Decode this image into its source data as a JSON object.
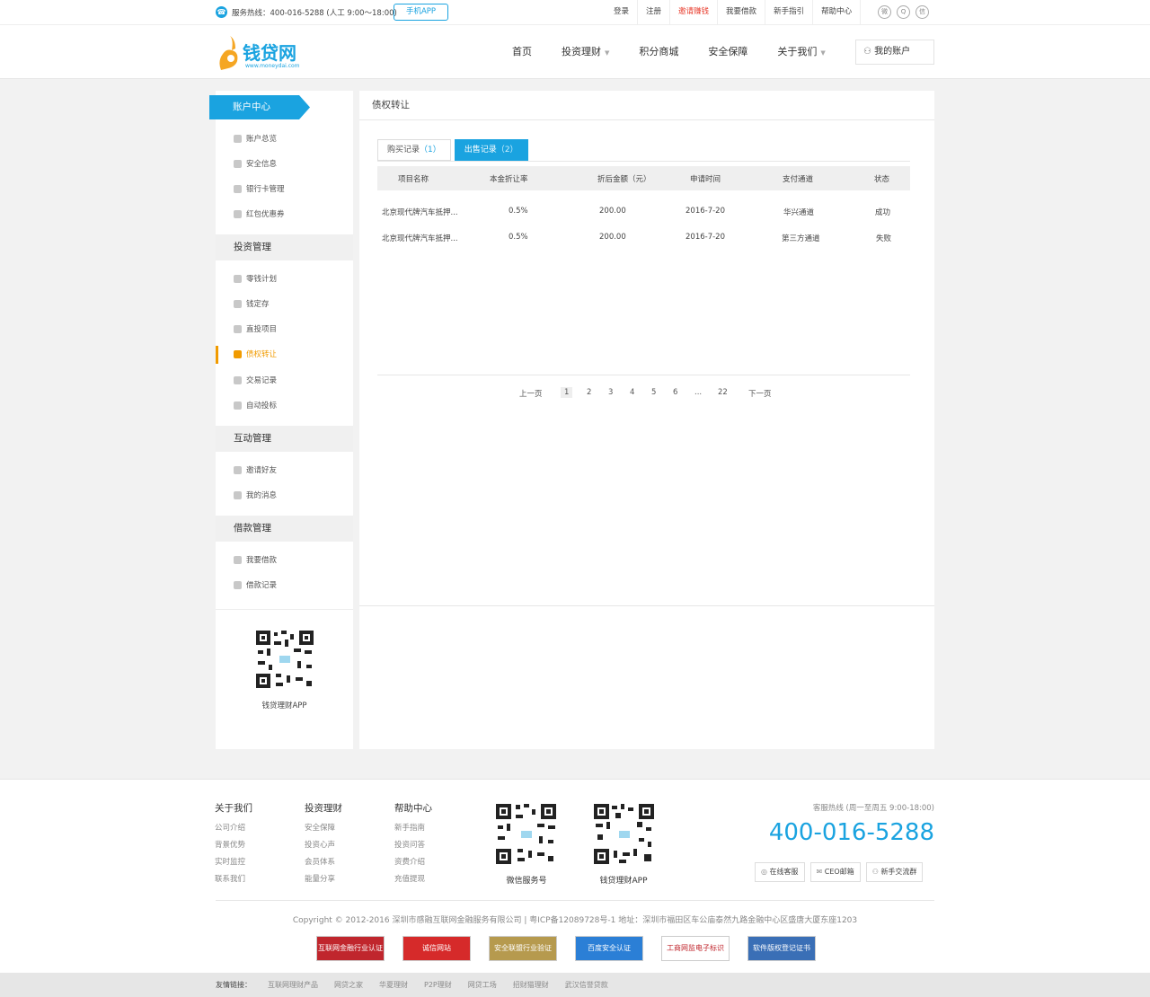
{
  "topbar": {
    "hotline": "服务热线：400-016-5288 (人工 9:00～18:00)",
    "app_button": "手机APP",
    "links": [
      "登录",
      "注册",
      "邀请赚钱",
      "我要借款",
      "新手指引",
      "帮助中心"
    ]
  },
  "header": {
    "logo_text": "钱贷网",
    "logo_url": "www.moneydai.com",
    "nav": [
      "首页",
      "投资理财",
      "积分商城",
      "安全保障",
      "关于我们"
    ],
    "my_account": "我的账户"
  },
  "sidebar": {
    "head": "账户中心",
    "account_items": [
      "账户总览",
      "安全信息",
      "银行卡管理",
      "红包优惠券"
    ],
    "group_invest": "投资管理",
    "invest_items": [
      "零钱计划",
      "钱定存",
      "直投项目",
      "债权转让",
      "交易记录",
      "自动投标"
    ],
    "group_interact": "互动管理",
    "interact_items": [
      "邀请好友",
      "我的消息"
    ],
    "group_loan": "借款管理",
    "loan_items": [
      "我要借款",
      "借款记录"
    ],
    "qr_caption": "钱贷理财APP"
  },
  "main": {
    "title": "债权转让",
    "tabs": [
      {
        "label": "购买记录",
        "count": "1"
      },
      {
        "label": "出售记录",
        "count": "2"
      }
    ],
    "columns": [
      "项目名称",
      "本金折让率",
      "折后金额（元）",
      "申请时间",
      "支付通道",
      "状态"
    ],
    "rows": [
      [
        "北京现代牌汽车抵押...",
        "0.5%",
        "200.00",
        "2016-7-20",
        "华兴通道",
        "成功"
      ],
      [
        "北京现代牌汽车抵押...",
        "0.5%",
        "200.00",
        "2016-7-20",
        "第三方通道",
        "失败"
      ]
    ],
    "pager": [
      "上一页",
      "1",
      "2",
      "3",
      "4",
      "5",
      "6",
      "...",
      "22",
      "下一页"
    ]
  },
  "footer": {
    "col1": {
      "head": "关于我们",
      "items": [
        "公司介绍",
        "背景优势",
        "实时监控",
        "联系我们"
      ]
    },
    "col2": {
      "head": "投资理财",
      "items": [
        "安全保障",
        "投资心声",
        "会员体系",
        "能量分享"
      ]
    },
    "col3": {
      "head": "帮助中心",
      "items": [
        "新手指南",
        "投资问答",
        "资费介绍",
        "充值提现"
      ]
    },
    "qr1": "微信服务号",
    "qr2": "钱贷理财APP",
    "hotline_label": "客服热线 (周一至周五 9:00-18:00)",
    "hotline": "400-016-5288",
    "buttons": [
      "在线客服",
      "CEO邮箱",
      "新手交流群"
    ],
    "copyright": "Copyright © 2012-2016 深圳市感融互联网金融服务有限公司 | 粤ICP备12089728号-1 地址：深圳市福田区车公庙泰然九路金融中心区盛唐大厦东座1203",
    "badges": [
      "互联网金融行业认证",
      "诚信网站",
      "安全联盟行业验证",
      "百度安全认证",
      "工商网监电子标识",
      "软件版权登记证书"
    ],
    "friend_label": "友情链接：",
    "friend_links": [
      "互联网理财产品",
      "网贷之家",
      "华夏理财",
      "P2P理财",
      "网贷工场",
      "招财猫理财",
      "武汉信誉贷款"
    ]
  },
  "colors": {
    "accent": "#1aa3e0",
    "active": "#f19b00",
    "hot_link": "#e83c2d"
  }
}
